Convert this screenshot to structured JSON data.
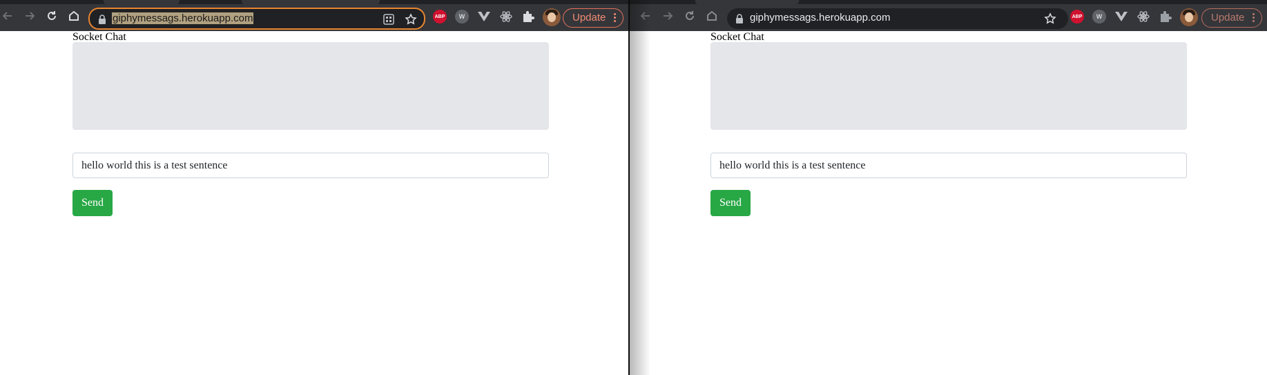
{
  "windows": [
    {
      "side": "left",
      "address_bar": {
        "url": "giphymessags.herokuapp.com",
        "focused": true,
        "url_selected": true
      },
      "extensions": {
        "abp_label": "ABP",
        "wv_label": "W"
      },
      "update_label": "Update",
      "app": {
        "title": "Socket Chat",
        "input_value": "hello world this is a test sentence",
        "send_label": "Send"
      }
    },
    {
      "side": "right",
      "address_bar": {
        "url": "giphymessags.herokuapp.com",
        "focused": false,
        "url_selected": false
      },
      "extensions": {
        "abp_label": "ABP",
        "wv_label": "W"
      },
      "update_label": "Update",
      "app": {
        "title": "Socket Chat",
        "input_value": "hello world this is a test sentence",
        "send_label": "Send"
      }
    }
  ],
  "icons": [
    "back-arrow-icon",
    "forward-arrow-icon",
    "reload-icon",
    "home-icon",
    "lock-icon",
    "qr-code-icon",
    "bookmark-star-icon",
    "adblock-plus-icon",
    "wv-extension-icon",
    "vue-devtools-icon",
    "react-devtools-icon",
    "puzzle-extensions-icon",
    "profile-avatar",
    "kebab-menu-icon"
  ],
  "colors": {
    "toolbar": "#35363a",
    "omnibox": "#202124",
    "focus_ring": "#e8862f",
    "update_accent": "#f28b75",
    "chat_box": "#e4e6ea",
    "send_button": "#28a745"
  }
}
